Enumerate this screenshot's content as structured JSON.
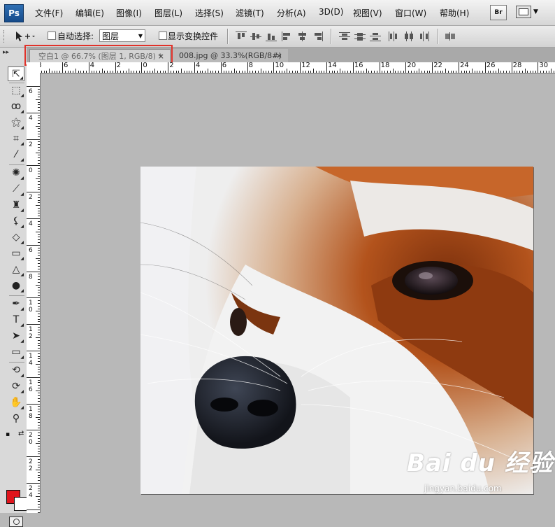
{
  "app": {
    "logo": "Ps",
    "bridge_label": "Br"
  },
  "menu": [
    "文件(F)",
    "编辑(E)",
    "图像(I)",
    "图层(L)",
    "选择(S)",
    "滤镜(T)",
    "分析(A)",
    "3D(D)",
    "视图(V)",
    "窗口(W)",
    "帮助(H)"
  ],
  "options": {
    "auto_select_label": "自动选择:",
    "auto_select_value": "图层",
    "show_transform_label": "显示变换控件"
  },
  "tabs": [
    {
      "label": "空白1 @ 66.7% (图层 1, RGB/8) *",
      "close": "×",
      "active": true
    },
    {
      "label": "008.jpg @ 33.3%(RGB/8#)",
      "close": "×",
      "active": false
    }
  ],
  "ruler": {
    "h_numbers": [
      "8",
      "6",
      "4",
      "2",
      "0",
      "2",
      "4",
      "6",
      "8",
      "10",
      "12",
      "14",
      "16",
      "18",
      "20",
      "22",
      "24",
      "26",
      "28",
      "30"
    ],
    "v_numbers": [
      "6",
      "4",
      "2",
      "0",
      "2",
      "4",
      "6",
      "8",
      "1\n0",
      "1\n2",
      "1\n4",
      "1\n6",
      "1\n8",
      "2\n0",
      "2\n2",
      "2\n4"
    ]
  },
  "colors": {
    "foreground": "#e0141c",
    "background": "#ffffff",
    "highlight": "#e0322a"
  },
  "watermark": {
    "main": "Bai du 经验",
    "url": "jingyan.baidu.com"
  }
}
